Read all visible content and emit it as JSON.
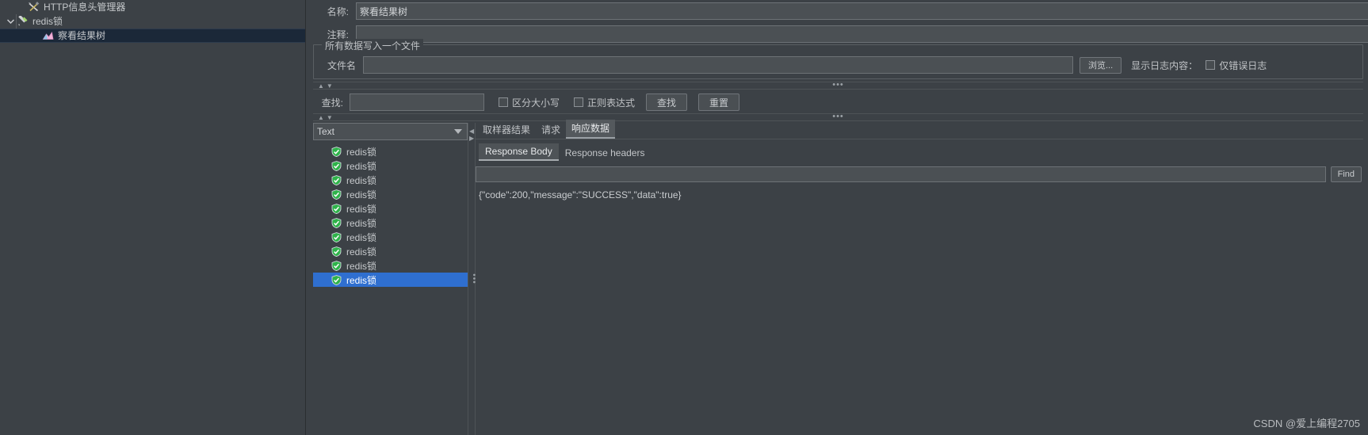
{
  "tree": {
    "items": [
      {
        "label": "HTTP信息头管理器",
        "icon": "wrench-screwdriver-icon",
        "depth": 1,
        "twisty": "",
        "selected": false
      },
      {
        "label": "redis锁",
        "icon": "test-tube-icon",
        "depth": 0,
        "twisty": "v",
        "selected": false
      },
      {
        "label": "察看结果树",
        "icon": "chart-icon",
        "depth": 2,
        "twisty": "",
        "selected": true
      }
    ]
  },
  "editor": {
    "name_label": "名称:",
    "name_value": "察看结果树",
    "comment_label": "注释:",
    "comment_value": "",
    "file_group": {
      "title": "所有数据写入一个文件",
      "filename_label": "文件名",
      "filename_value": "",
      "browse_button": "浏览...",
      "log_display_label": "显示日志内容：",
      "errors_only_label": "仅错误日志"
    },
    "search": {
      "label": "查找:",
      "value": "",
      "case_sensitive_label": "区分大小写",
      "regex_label": "正则表达式",
      "search_button": "查找",
      "reset_button": "重置"
    },
    "renderer": {
      "selected": "Text"
    },
    "results": [
      {
        "label": "redis锁",
        "status": "success",
        "selected": false
      },
      {
        "label": "redis锁",
        "status": "success",
        "selected": false
      },
      {
        "label": "redis锁",
        "status": "success",
        "selected": false
      },
      {
        "label": "redis锁",
        "status": "success",
        "selected": false
      },
      {
        "label": "redis锁",
        "status": "success",
        "selected": false
      },
      {
        "label": "redis锁",
        "status": "success",
        "selected": false
      },
      {
        "label": "redis锁",
        "status": "success",
        "selected": false
      },
      {
        "label": "redis锁",
        "status": "success",
        "selected": false
      },
      {
        "label": "redis锁",
        "status": "success",
        "selected": false
      },
      {
        "label": "redis锁",
        "status": "success",
        "selected": true
      }
    ],
    "tabs": [
      {
        "label": "取样器结果",
        "active": false
      },
      {
        "label": "请求",
        "active": false
      },
      {
        "label": "响应数据",
        "active": true
      }
    ],
    "subtabs": [
      {
        "label": "Response Body",
        "active": true
      },
      {
        "label": "Response headers",
        "active": false
      }
    ],
    "find": {
      "value": "",
      "button": "Find"
    },
    "response_body": "{\"code\":200,\"message\":\"SUCCESS\",\"data\":true}"
  },
  "watermark": "CSDN @爱上编程2705"
}
